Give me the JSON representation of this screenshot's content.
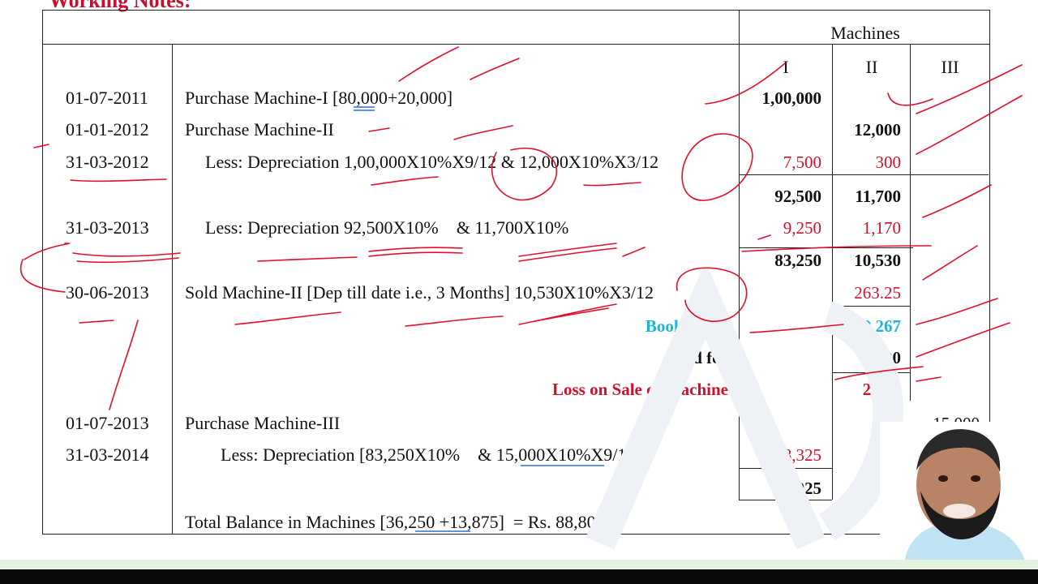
{
  "note": {
    "heading": "Working Notes:"
  },
  "header": {
    "machines": "Machines",
    "col1": "I",
    "col2": "II",
    "col3": "III"
  },
  "rows": [
    {
      "date": "01-07-2011",
      "text": "Purchase Machine-I  [80,000+20,000]",
      "m1": "1,00,000",
      "m2": "",
      "m3": ""
    },
    {
      "date": "01-01-2012",
      "text": "Purchase Machine-II",
      "m1": "",
      "m2": "12,000",
      "m3": ""
    },
    {
      "date": "31-03-2012",
      "text": "Less: Depreciation 1,00,000X10%X9/12 & 12,000X10%X3/12",
      "m1": "7,500",
      "m2": "300",
      "m3": ""
    },
    {
      "date": "",
      "text": "",
      "m1": "92,500",
      "m2": "11,700",
      "m3": ""
    },
    {
      "date": "31-03-2013",
      "text": "Less: Depreciation 92,500X10%    & 11,700X10%",
      "m1": "9,250",
      "m2": "1,170",
      "m3": ""
    },
    {
      "date": "",
      "text": "",
      "m1": "83,250",
      "m2": "10,530",
      "m3": ""
    },
    {
      "date": "30-06-2013",
      "text": "Sold Machine-II [Dep till date i.e., 3 Months] 10,530X10%X3/12",
      "m1": "",
      "m2": "263.25",
      "m3": ""
    },
    {
      "date": "",
      "text": "",
      "m1": "",
      "m2": "",
      "m3": ""
    }
  ],
  "book_value": {
    "label": "Book Value",
    "value": "10,267"
  },
  "sold_for": {
    "label": "Sold for",
    "value": "8,000"
  },
  "loss": {
    "label": "Loss on Sale of Machine",
    "value": "2,267"
  },
  "row_2013": {
    "date": "01-07-2013",
    "text": "Purchase Machine-III",
    "m3": "15,000"
  },
  "row_2014": {
    "date": "31-03-2014",
    "text": "Less: Depreciation [83,250X10%    & 15,000X10%X9/12",
    "m1": "8,325"
  },
  "balance_m1": "74,925",
  "total": "Total Balance in Machines [36,250 +13,875]  = Rs. 88,800",
  "colors": {
    "red": "#d0102a",
    "cyan": "#19b3dc",
    "ink": "#e0102a"
  }
}
